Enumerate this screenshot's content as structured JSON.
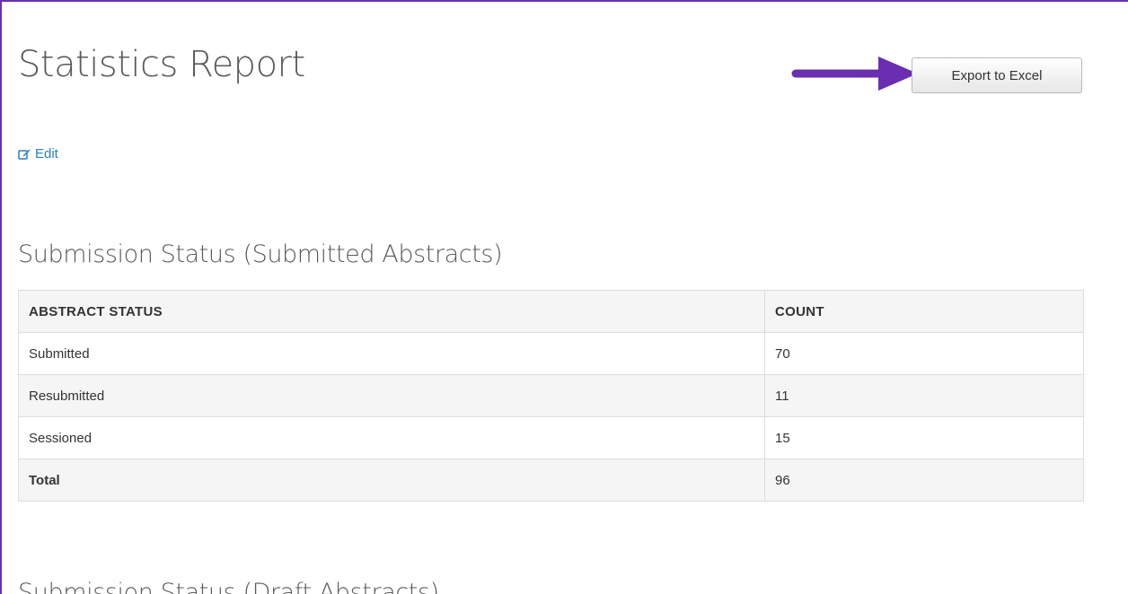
{
  "page": {
    "title": "Statistics Report",
    "edit_label": "Edit",
    "export_label": "Export to Excel",
    "accent_color": "#6a2fb0",
    "link_color": "#2a7fc0"
  },
  "icons": {
    "edit": "edit-icon",
    "arrow": "arrow-right-icon"
  },
  "submitted_section": {
    "heading": "Submission Status (Submitted Abstracts)",
    "columns": [
      "ABSTRACT STATUS",
      "COUNT"
    ],
    "rows": [
      {
        "status": "Submitted",
        "count": "70"
      },
      {
        "status": "Resubmitted",
        "count": "11"
      },
      {
        "status": "Sessioned",
        "count": "15"
      }
    ],
    "total": {
      "label": "Total",
      "count": "96"
    }
  },
  "draft_section": {
    "heading": "Submission Status (Draft Abstracts)"
  }
}
